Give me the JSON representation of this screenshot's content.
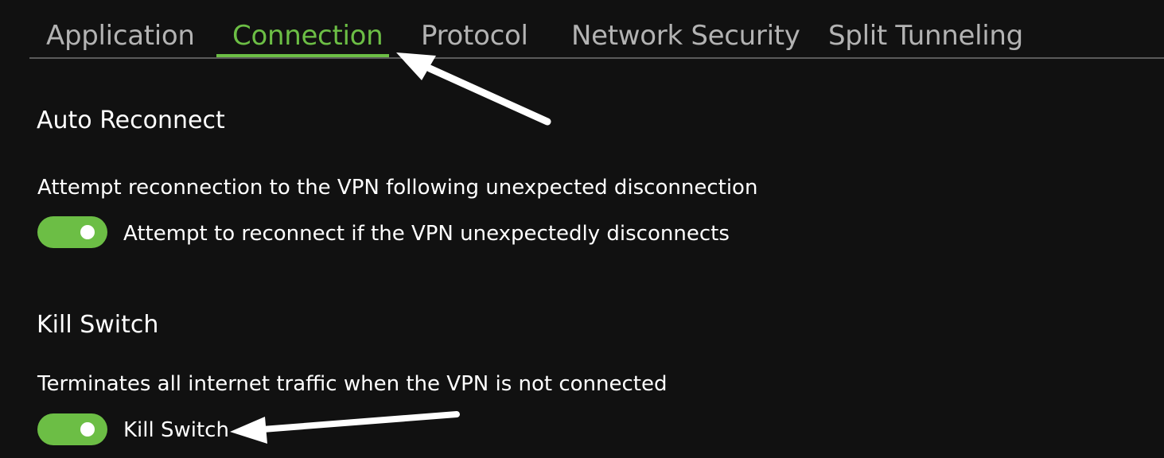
{
  "tabs": [
    {
      "label": "Application",
      "active": false
    },
    {
      "label": "Connection",
      "active": true
    },
    {
      "label": "Protocol",
      "active": false
    },
    {
      "label": "Network Security",
      "active": false
    },
    {
      "label": "Split Tunneling",
      "active": false
    }
  ],
  "auto_reconnect": {
    "title": "Auto Reconnect",
    "description": "Attempt reconnection to the VPN following unexpected disconnection",
    "toggle_label": "Attempt to reconnect if the VPN unexpectedly disconnects",
    "enabled": true
  },
  "kill_switch": {
    "title": "Kill Switch",
    "description": "Terminates all internet traffic when the VPN is not connected",
    "toggle_label": "Kill Switch",
    "enabled": true
  },
  "colors": {
    "background": "#111111",
    "accent": "#6cbe45",
    "tab_inactive": "#b3b3b3",
    "text": "#ffffff"
  },
  "icons": {
    "annotation_arrow_1": "arrow-icon",
    "annotation_arrow_2": "arrow-icon"
  }
}
